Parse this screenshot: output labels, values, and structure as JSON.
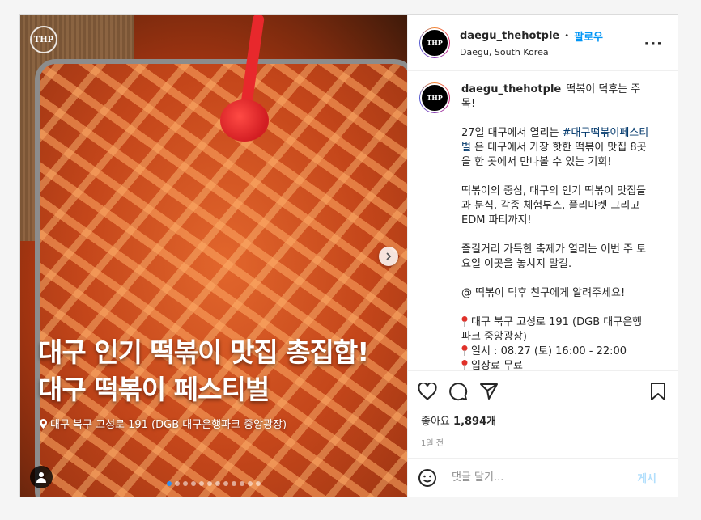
{
  "media": {
    "logo_text": "THP",
    "headline_line1": "대구 인기 떡볶이 맛집 총집합!",
    "headline_line2": "대구 떡볶이 페스티벌",
    "location_line": "대구 북구 고성로 191 (DGB 대구은행파크 중앙광장)",
    "carousel_dots": 12,
    "active_dot": 0
  },
  "header": {
    "avatar_text": "THP",
    "username": "daegu_thehotple",
    "separator": "•",
    "follow_label": "팔로우",
    "location": "Daegu, South Korea",
    "more_icon": "···"
  },
  "caption": {
    "username": "daegu_thehotple",
    "intro": "떡볶이 덕후는 주목!",
    "p1_before": "27일 대구에서 열리는 ",
    "p1_hashtag": "#대구떡볶이페스티벌",
    "p1_after": " 은 대구에서 가장 핫한 떡볶이 맛집 8곳을 한 곳에서 만나볼 수 있는 기회!",
    "p2": "떡볶이의 중심, 대구의 인기 떡볶이 맛집들과 분식, 각종 체험부스, 플리마켓 그리고 EDM 파티까지!",
    "p3": "즐길거리 가득한 축제가 열리는 이번 주 토요일 이곳을 놓치지 말길.",
    "p4": "@ 떡볶이 덕후 친구에게 알려주세요!",
    "detail_address": "대구 북구 고성로 191 (DGB 대구은행파크 중앙광장)",
    "detail_time": "일시 : 08.27 (토) 16:00 - 22:00",
    "detail_fee": "입장료 무료"
  },
  "likes": {
    "label": "좋아요",
    "count": "1,894개"
  },
  "time_ago": "1일 전",
  "comment": {
    "placeholder": "댓글 달기...",
    "post_label": "게시"
  },
  "colors": {
    "accent": "#0095f6",
    "hashtag": "#00376b",
    "pin_red": "#e0312a"
  }
}
